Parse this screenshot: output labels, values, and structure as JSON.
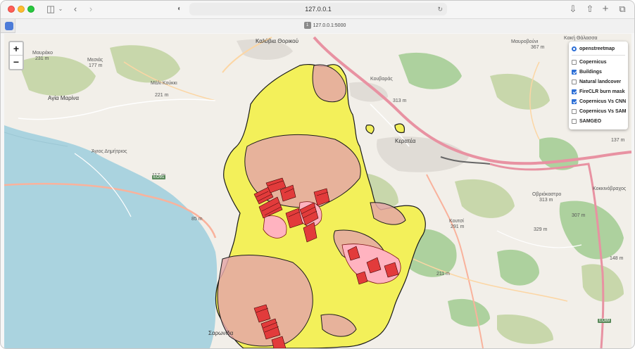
{
  "browser": {
    "url": "127.0.0.1",
    "tab_title": "127.0.0.1:5000",
    "tab_number": "1"
  },
  "map": {
    "zoom_in_label": "+",
    "zoom_out_label": "−",
    "labels": {
      "kalyvia": "Καλύβια Θορικού",
      "agia_marina": "Αγία Μαρίνα",
      "agios_dimitrios": "Άγιος Δημήτριος",
      "keratea": "Κερατέα",
      "kouvaras": "Κουβαράς",
      "saronida": "Σαρωνίδα",
      "kaki_thalassa": "Κακή Θάλασσα",
      "mavrako": "Μαυράκο",
      "mavrako_ele": "231 m",
      "mesias": "Μεσιάς",
      "mesias_ele": "177 m",
      "mali_koukki": "Μάλι Κούκκι",
      "mali_ele": "221 m",
      "ovriokastro": "Οβριόκαστρο",
      "ovrio_ele": "313 m",
      "kokkinovrachos": "Κοκκινόβραχος",
      "kokk_ele": "148 m",
      "koutsi": "Κουτσί",
      "koutsi_ele": "291 m",
      "ele_313": "313 m",
      "ele_329": "329 m",
      "ele_307": "307 m",
      "ele_211": "211 m",
      "ele_117": "117 m",
      "ele_85": "85 m",
      "ele_137": "137 m",
      "mavrovouni": "Μαυροβούνι",
      "mavro_ele": "367 m"
    },
    "road_shields": {
      "eo91": "ΕΟ91",
      "eo89": "ΕΟ89"
    },
    "colors": {
      "land": "#f2efe9",
      "sea": "#aad3df",
      "forest": "#add19e",
      "scrub": "#c8d7ab",
      "copernicus_fill": "#f3f05a",
      "burn_mask_fill": "#e4a7a7",
      "cnn_fill": "#ff9090",
      "buildings": "#e23b3b",
      "motorway": "#e892a2"
    }
  },
  "layers": {
    "base": [
      {
        "label": "openstreetmap",
        "checked": true
      }
    ],
    "overlays": [
      {
        "label": "Copernicus",
        "checked": false
      },
      {
        "label": "Buildings",
        "checked": true
      },
      {
        "label": "Natural landcover",
        "checked": false
      },
      {
        "label": "FireCLR burn mask",
        "checked": true
      },
      {
        "label": "Copernicus Vs CNN",
        "checked": true
      },
      {
        "label": "Copernicus Vs SAM",
        "checked": false
      },
      {
        "label": "SAMGEO",
        "checked": false
      }
    ]
  }
}
